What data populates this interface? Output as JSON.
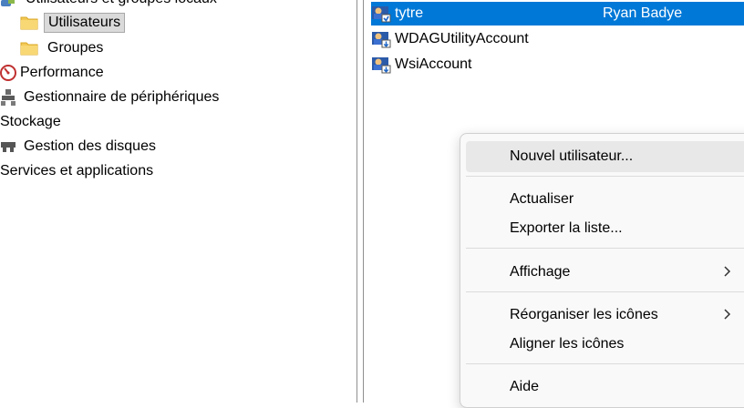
{
  "tree": {
    "items": [
      {
        "label": "Utilisateurs et groupes locaux",
        "icon": "users-groups-icon"
      },
      {
        "label": "Utilisateurs",
        "icon": "folder-icon"
      },
      {
        "label": "Groupes",
        "icon": "folder-icon"
      },
      {
        "label": "Performance",
        "icon": "performance-icon"
      },
      {
        "label": "Gestionnaire de périphériques",
        "icon": "device-manager-icon"
      },
      {
        "label": "Stockage"
      },
      {
        "label": "Gestion des disques",
        "icon": "disk-management-icon"
      },
      {
        "label": "Services et applications"
      }
    ]
  },
  "list": {
    "rows": [
      {
        "name": "tytre",
        "full_name": "Ryan Badye"
      },
      {
        "name": "WDAGUtilityAccount",
        "full_name": ""
      },
      {
        "name": "WsiAccount",
        "full_name": ""
      }
    ]
  },
  "context_menu": {
    "items": [
      {
        "label": "Nouvel utilisateur..."
      },
      {
        "label": "Actualiser"
      },
      {
        "label": "Exporter la liste..."
      },
      {
        "label": "Affichage",
        "submenu": true
      },
      {
        "label": "Réorganiser les icônes",
        "submenu": true
      },
      {
        "label": "Aligner les icônes"
      },
      {
        "label": "Aide"
      }
    ]
  },
  "colors": {
    "selection": "#0078d7",
    "tree_selection": "#dadada",
    "menu_background": "#f9f9f9",
    "menu_hover": "#e8e8e8"
  }
}
